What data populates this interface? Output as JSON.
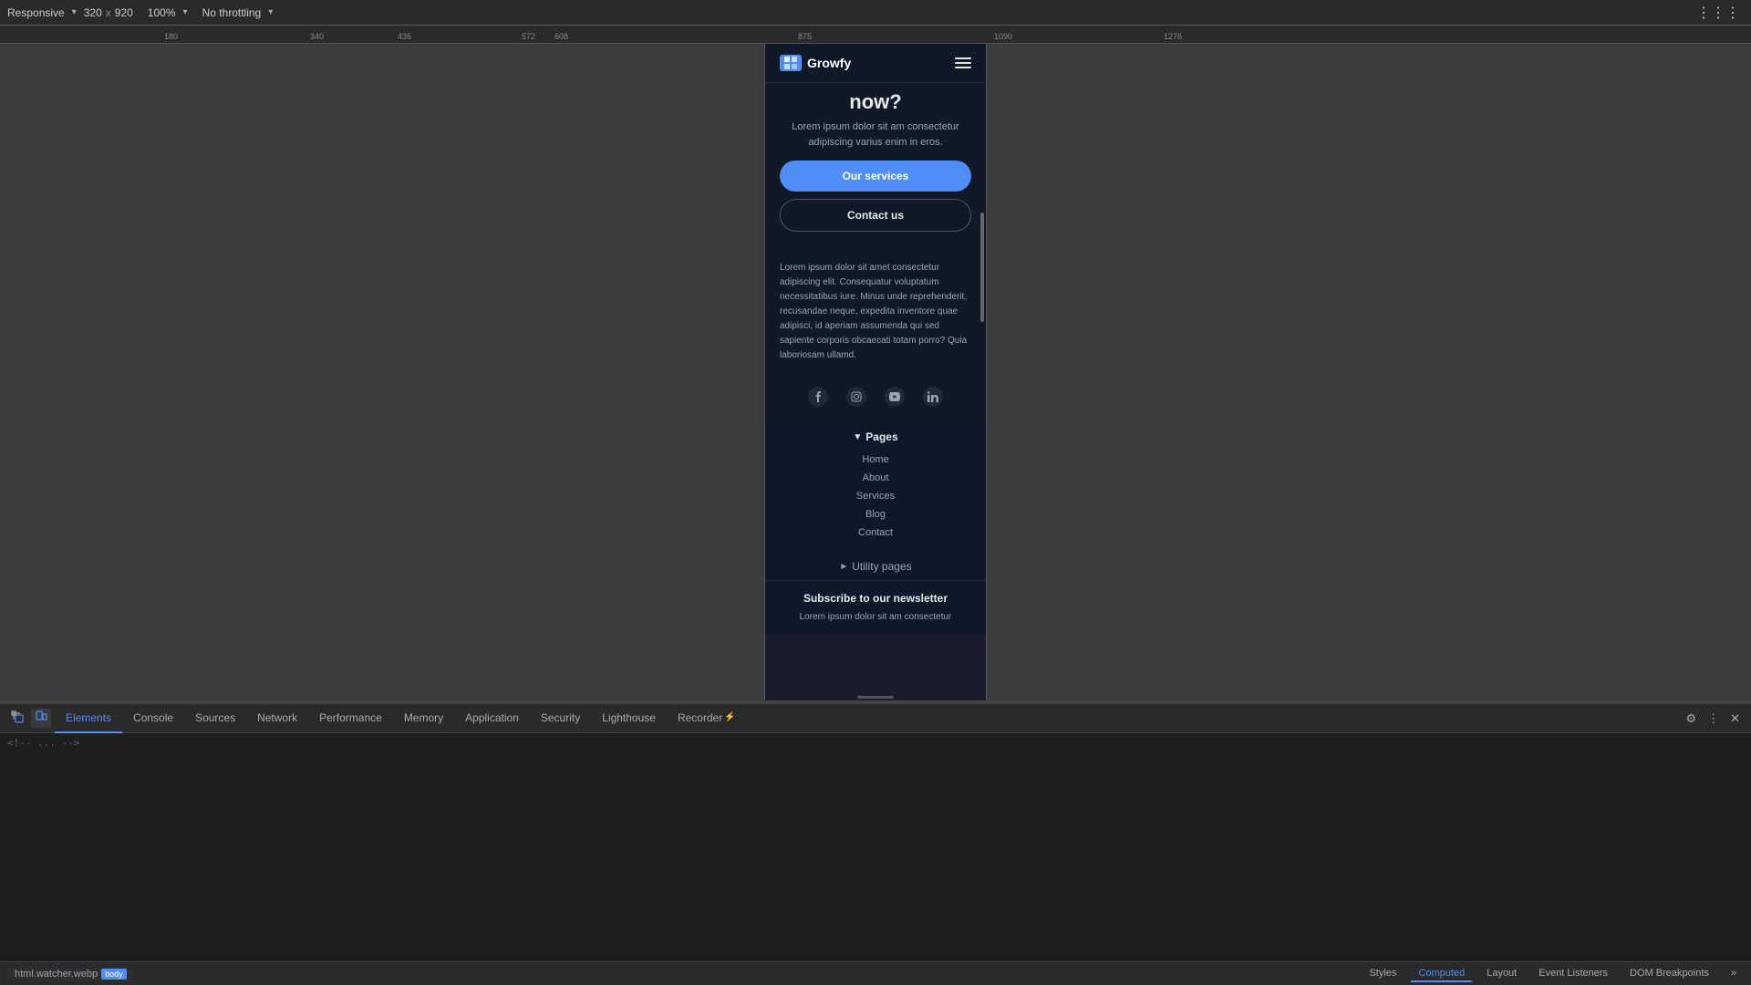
{
  "toolbar": {
    "responsive_label": "Responsive",
    "width": "320",
    "x_separator": "x",
    "height": "920",
    "zoom": "100%",
    "throttle": "No throttling",
    "dropdown_arrow": "▾"
  },
  "navbar": {
    "logo_text": "Growfy",
    "logo_mark": "🌱"
  },
  "hero": {
    "heading": "now?",
    "body_text": "Lorem ipsum dolor sit am consectetur adipiscing varius enim in eros.",
    "btn_services": "Our services",
    "btn_contact": "Contact us"
  },
  "about": {
    "text": "Lorem ipsum dolor sit amet consectetur adipiscing elit. Consequatur voluptatum necessitatibus iure. Minus unde reprehenderit, recusandae neque, expedita inventore quae adipisci, id aperiam assumenda qui sed sapiente corporis obcaecati totam porro? Quia laboriosam ullamd."
  },
  "social": {
    "facebook": "f",
    "instagram": "◎",
    "youtube": "▶",
    "linkedin": "in"
  },
  "footer_nav": {
    "pages_label": "Pages",
    "pages_arrow": "▼",
    "items": [
      "Home",
      "About",
      "Services",
      "Blog",
      "Contact"
    ],
    "utility_label": "Utility pages",
    "utility_arrow": "►"
  },
  "newsletter": {
    "title": "Subscribe to our newsletter",
    "desc": "Lorem ipsum dolor sit am consectetur"
  },
  "devtools": {
    "tabs": [
      "Elements",
      "Console",
      "Sources",
      "Network",
      "Performance",
      "Memory",
      "Application",
      "Security",
      "Lighthouse",
      "Recorder"
    ],
    "active_tab": "Elements",
    "breadcrumb_html": "html.watcher.webp",
    "breadcrumb_body": "body",
    "right_tabs": [
      "Styles",
      "Computed",
      "Layout",
      "Event Listeners",
      "DOM Breakpoints"
    ],
    "active_right_tab": "Computed",
    "computed_label": "Computed"
  },
  "colors": {
    "accent": "#4f8ef7",
    "bg_dark": "#111827",
    "bg_darker": "#0f172a",
    "text_primary": "#e5e7eb",
    "text_muted": "#9ca3af",
    "devtools_bg": "#1e1e1e",
    "devtools_tab_bg": "#2a2a2a"
  }
}
